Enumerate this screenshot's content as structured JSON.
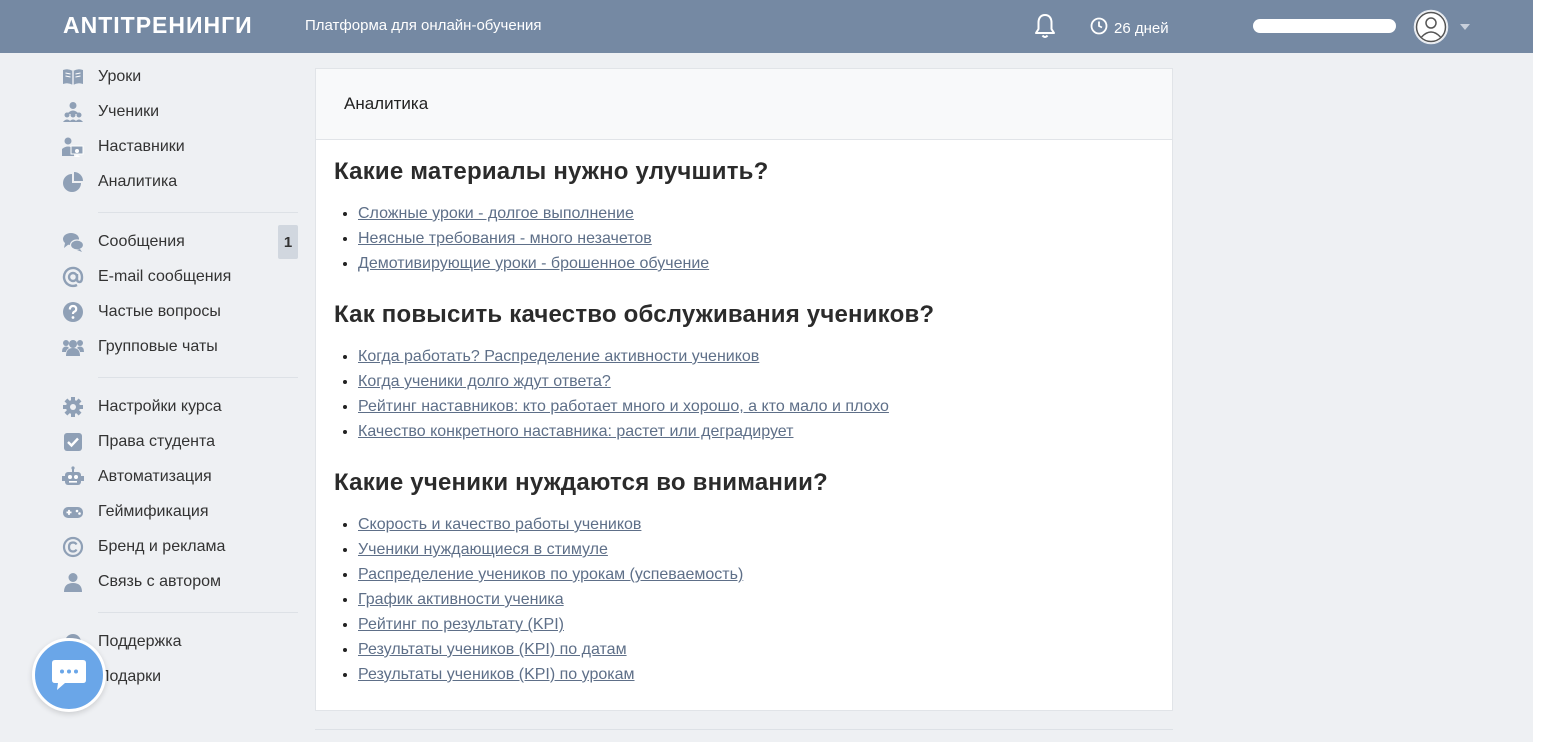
{
  "header": {
    "logo": "ANTITРЕНИНГИ",
    "tagline": "Платформа для онлайн-обучения",
    "days": "26 дней",
    "icons": [
      "bell-icon",
      "clock-icon",
      "avatar-icon",
      "chevron-down-icon"
    ]
  },
  "sidebar": {
    "group1": [
      {
        "label": "Уроки",
        "icon": "book-icon"
      },
      {
        "label": "Ученики",
        "icon": "students-icon"
      },
      {
        "label": "Наставники",
        "icon": "mentors-icon"
      },
      {
        "label": "Аналитика",
        "icon": "pie-chart-icon"
      }
    ],
    "group2": [
      {
        "label": "Сообщения",
        "icon": "chat-icon",
        "badge": "1"
      },
      {
        "label": "E-mail сообщения",
        "icon": "at-icon"
      },
      {
        "label": "Частые вопросы",
        "icon": "question-icon"
      },
      {
        "label": "Групповые чаты",
        "icon": "group-icon"
      }
    ],
    "group3": [
      {
        "label": "Настройки курса",
        "icon": "gear-icon"
      },
      {
        "label": "Права студента",
        "icon": "checkbox-icon"
      },
      {
        "label": "Автоматизация",
        "icon": "robot-icon"
      },
      {
        "label": "Геймификация",
        "icon": "gamepad-icon"
      },
      {
        "label": "Бренд и реклама",
        "icon": "copyright-icon"
      },
      {
        "label": "Связь с автором",
        "icon": "user-icon"
      }
    ],
    "group4": [
      {
        "label": "Поддержка",
        "icon": "support-icon"
      },
      {
        "label": "Подарки",
        "icon": "gift-icon"
      }
    ]
  },
  "panel": {
    "title": "Аналитика",
    "sections": [
      {
        "heading": "Какие материалы нужно улучшить?",
        "links": [
          "Сложные уроки - долгое выполнение",
          "Неясные требования - много незачетов",
          "Демотивирующие уроки - брошенное обучение"
        ]
      },
      {
        "heading": "Как повысить качество обслуживания учеников?",
        "links": [
          "Когда работать? Распределение активности учеников",
          "Когда ученики долго ждут ответа?",
          "Рейтинг наставников: кто работает много и хорошо, а кто мало и плохо",
          "Качество конкретного наставника: растет или деградирует"
        ]
      },
      {
        "heading": "Какие ученики нуждаются во внимании?",
        "links": [
          "Скорость и качество работы учеников",
          "Ученики нуждающиеся в стимуле",
          "Распределение учеников по урокам (успеваемость)",
          "График активности ученика",
          "Рейтинг по результату (KPI)",
          "Результаты учеников (KPI) по датам",
          "Результаты учеников (KPI) по урокам"
        ]
      }
    ]
  },
  "colors": {
    "header_bg": "#7589a3",
    "link": "#5e6f88",
    "icon": "#8fa0b6",
    "chat_button": "#6aa6e8"
  }
}
